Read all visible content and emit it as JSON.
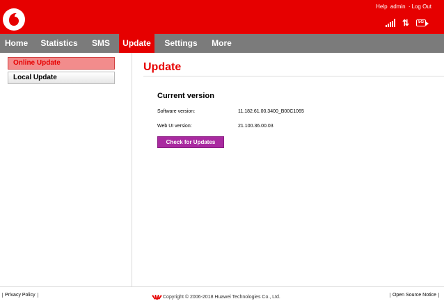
{
  "header": {
    "help_label": "Help",
    "user_label": "admin",
    "logout_label": "Log Out",
    "network_badge": "5G",
    "brand_color": "#e60000"
  },
  "nav": {
    "items": [
      {
        "label": "Home"
      },
      {
        "label": "Statistics"
      },
      {
        "label": "SMS"
      },
      {
        "label": "Update",
        "active": true
      },
      {
        "label": "Settings"
      },
      {
        "label": "More"
      }
    ]
  },
  "sidebar": {
    "items": [
      {
        "label": "Online Update",
        "active": true
      },
      {
        "label": "Local Update"
      }
    ]
  },
  "main": {
    "title": "Update",
    "section_title": "Current version",
    "software_label": "Software version:",
    "software_value": "11.182.61.00.3400_B00C1065",
    "webui_label": "Web UI version:",
    "webui_value": "21.100.36.00.03",
    "check_button": "Check for Updates",
    "button_color": "#a92aa0"
  },
  "footer": {
    "privacy": "Privacy Policy",
    "copyright": "Copyright © 2006-2018 Huawei Technologies Co., Ltd.",
    "open_source": "Open Source Notice"
  }
}
